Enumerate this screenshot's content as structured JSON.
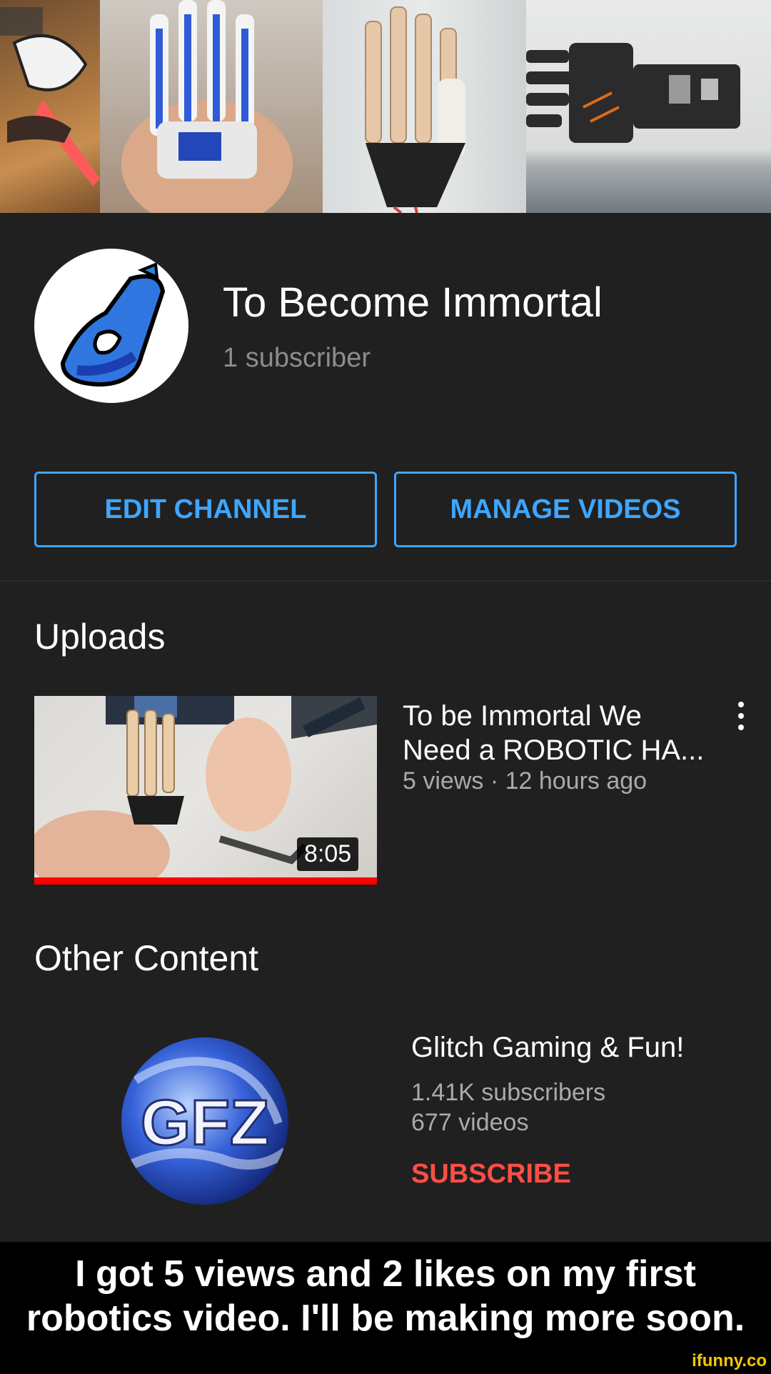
{
  "banner": {
    "alt": "Collage of robotic hand build photos"
  },
  "channel": {
    "title": "To Become Immortal",
    "subscribers": "1 subscriber",
    "edit_button": "EDIT CHANNEL",
    "manage_button": "MANAGE VIDEOS"
  },
  "uploads": {
    "heading": "Uploads",
    "video": {
      "title": "To be Immortal We Need a ROBOTIC HA...",
      "meta": "5 views · 12 hours ago",
      "duration": "8:05",
      "watched_fraction": 1.0
    }
  },
  "other": {
    "heading": "Other Content",
    "channel_name": "Glitch Gaming & Fun!",
    "subscribers": "1.41K subscribers",
    "videos": "677 videos",
    "subscribe_label": "SUBSCRIBE",
    "avatar_text": "GFZ"
  },
  "caption": {
    "text": "I got 5 views and 2 likes on my first robotics video. I'll be making more soon.",
    "watermark": "ifunny.co"
  },
  "colors": {
    "accent_blue": "#3ea6ff",
    "subscribe_red": "#ff4e45",
    "progress_red": "#ff0000",
    "background": "#202020"
  },
  "icons": [
    "channel-logo-icon",
    "more-vert-icon"
  ]
}
